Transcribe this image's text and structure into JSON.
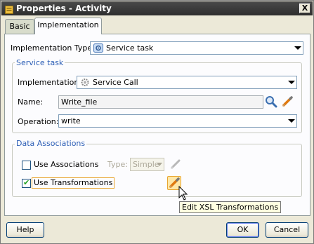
{
  "window": {
    "title": "Properties - Activity",
    "close_glyph": "X"
  },
  "tabs": [
    {
      "label": "Basic",
      "selected": false
    },
    {
      "label": "Implementation",
      "selected": true
    }
  ],
  "implementation_type": {
    "label": "Implementation Type:",
    "value": "Service task",
    "icon": "service-task-icon"
  },
  "service_task": {
    "legend": "Service task",
    "implementation_label": "Implementation:",
    "implementation_value": "Service Call",
    "implementation_icon": "gear-icon",
    "name_label": "Name:",
    "name_value": "Write_file",
    "operation_label": "Operation:",
    "operation_value": "write"
  },
  "data_associations": {
    "legend": "Data Associations",
    "use_associations_label": "Use Associations",
    "use_associations_checked": false,
    "type_label": "Type:",
    "type_value": "Simple",
    "use_transformations_label": "Use Transformations",
    "use_transformations_checked": true,
    "tooltip": "Edit XSL Transformations"
  },
  "footer": {
    "help_label": "Help",
    "ok_label": "OK",
    "cancel_label": "Cancel"
  },
  "colors": {
    "legend_blue": "#2d5fb6",
    "title_bar": "#3a3a3a",
    "highlight_orange": "#e8a530"
  }
}
